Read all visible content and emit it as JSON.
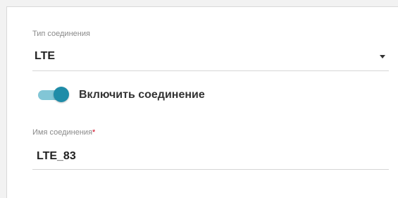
{
  "connection_type": {
    "label": "Тип соединения",
    "value": "LTE"
  },
  "enable_toggle": {
    "label": "Включить соединение",
    "checked": true,
    "track_color": "#82c6d6",
    "knob_color": "#1f8ca8"
  },
  "connection_name": {
    "label": "Имя соединения",
    "required_mark": "*",
    "value": "LTE_83"
  },
  "icons": {
    "dropdown": "chevron-down-icon"
  },
  "colors": {
    "required": "#d0021b",
    "underline": "#d6d6d6"
  }
}
